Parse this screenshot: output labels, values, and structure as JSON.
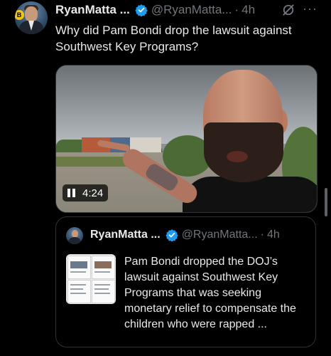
{
  "tweet": {
    "author_name": "RyanMatta ...",
    "handle": "@RyanMatta...",
    "separator": "·",
    "time": "4h",
    "more_label": "···",
    "text": "Why did Pam Bondi drop the lawsuit against Southwest Key Programs?",
    "avatar_badge": "B",
    "video": {
      "duration": "4:24",
      "state": "playing"
    }
  },
  "quoted_tweet": {
    "author_name": "RyanMatta ...",
    "handle": "@RyanMatta...",
    "separator": "·",
    "time": "4h",
    "text": "Pam Bondi dropped the DOJ’s lawsuit against Southwest Key Programs that was seeking monetary relief to compensate the children who were rapped ..."
  },
  "icons": [
    "verified-badge-icon",
    "grok-icon",
    "more-icon",
    "pause-icon"
  ],
  "colors": {
    "background": "#000000",
    "text": "#e7e9ea",
    "muted": "#71767b",
    "verified": "#1d9bf0",
    "border": "#2f3336"
  }
}
